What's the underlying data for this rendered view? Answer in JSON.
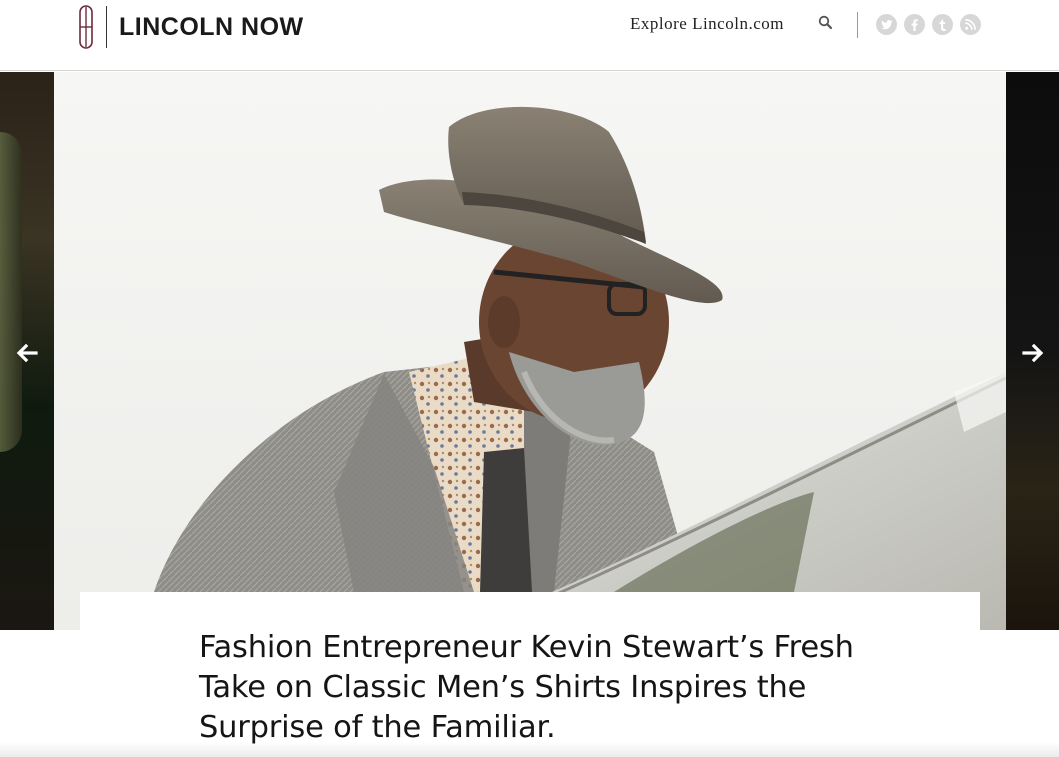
{
  "header": {
    "brand": "LINCOLN NOW",
    "explore_label": "Explore Lincoln.com",
    "icons": {
      "search": "search-icon",
      "social": [
        "twitter-icon",
        "facebook-icon",
        "tumblr-icon",
        "rss-icon"
      ]
    }
  },
  "carousel": {
    "prev_icon": "arrow-left-icon",
    "next_icon": "arrow-right-icon",
    "image_alt": "",
    "colors": {
      "arrow": "#ffffff",
      "social_bg": "#d7d7d7"
    }
  },
  "article": {
    "headline": "Fashion Entrepreneur Kevin Stewart’s Fresh Take on Classic Men’s Shirts Inspires the Surprise of the Familiar."
  }
}
